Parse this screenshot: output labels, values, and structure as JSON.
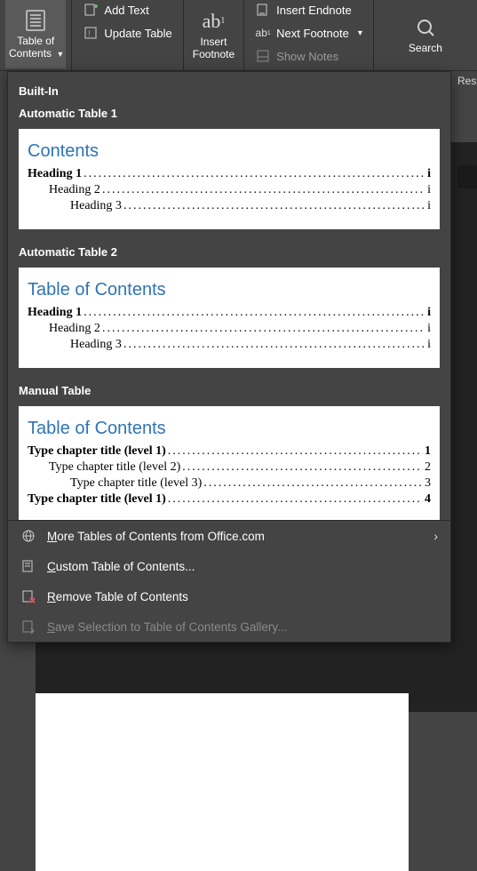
{
  "ribbon": {
    "toc_button": {
      "line1": "Table of",
      "line2": "Contents"
    },
    "add_text": "Add Text",
    "update_table": "Update Table",
    "insert_footnote": {
      "line1": "Insert",
      "line2": "Footnote",
      "glyph": "ab"
    },
    "insert_endnote": "Insert Endnote",
    "next_footnote": "Next Footnote",
    "show_notes": "Show Notes",
    "search": "Search"
  },
  "right_edge_text": "Res",
  "dropdown": {
    "builtin_header": "Built-In",
    "auto1": {
      "label": "Automatic Table 1",
      "title": "Contents",
      "lines": [
        {
          "text": "Heading 1",
          "page": "i",
          "indent": 0,
          "bold": true
        },
        {
          "text": "Heading 2",
          "page": "i",
          "indent": 1,
          "bold": false
        },
        {
          "text": "Heading 3",
          "page": "i",
          "indent": 2,
          "bold": false
        }
      ]
    },
    "auto2": {
      "label": "Automatic Table 2",
      "title": "Table of Contents",
      "lines": [
        {
          "text": "Heading 1",
          "page": "i",
          "indent": 0,
          "bold": true
        },
        {
          "text": "Heading 2",
          "page": "i",
          "indent": 1,
          "bold": false
        },
        {
          "text": "Heading 3",
          "page": "i",
          "indent": 2,
          "bold": false
        }
      ]
    },
    "manual": {
      "label": "Manual Table",
      "title": "Table of Contents",
      "lines": [
        {
          "text": "Type chapter title (level 1)",
          "page": "1",
          "indent": 0,
          "bold": true
        },
        {
          "text": "Type chapter title (level 2)",
          "page": "2",
          "indent": 1,
          "bold": false
        },
        {
          "text": "Type chapter title (level 3)",
          "page": "3",
          "indent": 2,
          "bold": false
        },
        {
          "text": "Type chapter title (level 1)",
          "page": "4",
          "indent": 0,
          "bold": true
        }
      ]
    },
    "commands": {
      "more": {
        "prefix": "M",
        "rest": "ore Tables of Contents from Office.com"
      },
      "custom": {
        "prefix": "C",
        "rest": "ustom Table of Contents..."
      },
      "remove": {
        "prefix": "R",
        "rest": "emove Table of Contents"
      },
      "save": {
        "prefix": "S",
        "rest": "ave Selection to Table of Contents Gallery..."
      }
    }
  }
}
